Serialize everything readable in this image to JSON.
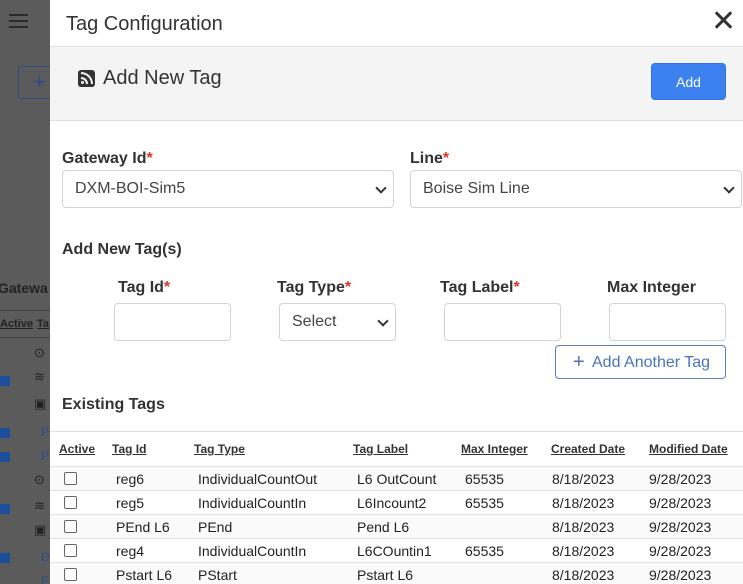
{
  "modal": {
    "title": "Tag Configuration",
    "section_title": "Add New Tag",
    "add_button": "Add",
    "gateway": {
      "label": "Gateway Id",
      "required_mark": "*",
      "value": "DXM-BOI-Sim5"
    },
    "line": {
      "label": "Line",
      "required_mark": "*",
      "value": "Boise Sim Line"
    },
    "add_new_heading": "Add New Tag(s)",
    "new_tag_fields": {
      "tag_id": {
        "label": "Tag Id",
        "required_mark": "*",
        "value": ""
      },
      "tag_type": {
        "label": "Tag Type",
        "required_mark": "*",
        "value": "Select"
      },
      "tag_label": {
        "label": "Tag Label",
        "required_mark": "*",
        "value": ""
      },
      "max_integer": {
        "label": "Max Integer",
        "value": ""
      }
    },
    "add_another_button": "Add Another Tag",
    "existing_heading": "Existing Tags",
    "columns": [
      "Active",
      "Tag Id",
      "Tag Type",
      "Tag Label",
      "Max Integer",
      "Created Date",
      "Modified Date"
    ],
    "rows": [
      {
        "tag_id": "reg6",
        "tag_type": "IndividualCountOut",
        "tag_label": "L6 OutCount",
        "max_integer": "65535",
        "created": "8/18/2023",
        "modified": "9/28/2023"
      },
      {
        "tag_id": "reg5",
        "tag_type": "IndividualCountIn",
        "tag_label": "L6Incount2",
        "max_integer": "65535",
        "created": "8/18/2023",
        "modified": "9/28/2023"
      },
      {
        "tag_id": "PEnd L6",
        "tag_type": "PEnd",
        "tag_label": "Pend L6",
        "max_integer": "",
        "created": "8/18/2023",
        "modified": "9/28/2023"
      },
      {
        "tag_id": "reg4",
        "tag_type": "IndividualCountIn",
        "tag_label": "L6COuntin1",
        "max_integer": "65535",
        "created": "8/18/2023",
        "modified": "9/28/2023"
      },
      {
        "tag_id": "Pstart L6",
        "tag_type": "PStart",
        "tag_label": "Pstart L6",
        "max_integer": "",
        "created": "8/18/2023",
        "modified": "9/28/2023"
      }
    ]
  },
  "background": {
    "plus_icon": "+",
    "partial_heading": "Gatewa",
    "col_active": "Active",
    "col_tag": "Ta",
    "links": [
      "P",
      "P",
      "D",
      "F"
    ]
  },
  "icons": {
    "menu": "hamburger-icon",
    "close": "close-icon",
    "rss": "rss-icon",
    "plus": "plus-icon",
    "chevron": "chevron-down-icon"
  },
  "colors": {
    "primary": "#3b82f0",
    "required": "#d9342b",
    "outline": "#4a73b8"
  }
}
